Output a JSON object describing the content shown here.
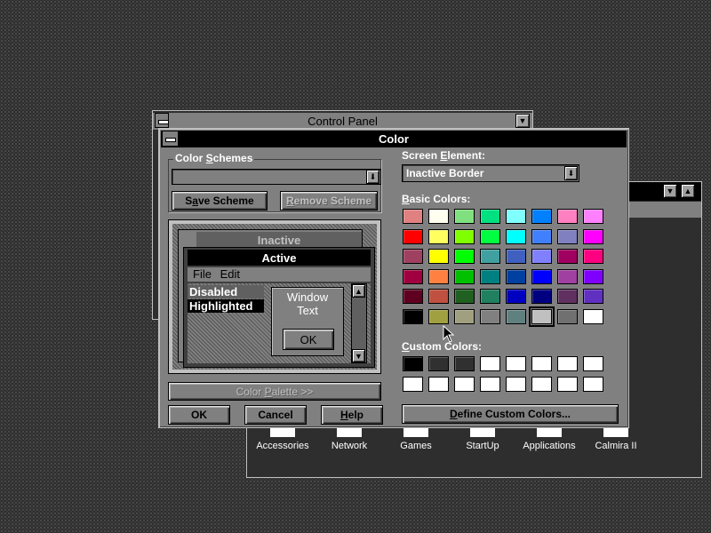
{
  "control_panel": {
    "title": "Control Panel"
  },
  "group_window": {
    "icons": [
      {
        "label": "Accessories"
      },
      {
        "label": "Network"
      },
      {
        "label": "Games"
      },
      {
        "label": "StartUp"
      },
      {
        "label": "Applications"
      },
      {
        "label": "Calmira II"
      }
    ]
  },
  "dialog": {
    "title": "Color",
    "color_schemes_label": "Color Schemes",
    "color_scheme_value": "",
    "save_scheme": "Save Scheme",
    "remove_scheme": "Remove Scheme",
    "preview": {
      "inactive_title": "Inactive",
      "active_title": "Active",
      "menu_file": "File",
      "menu_edit": "Edit",
      "disabled": "Disabled",
      "highlighted": "Highlighted",
      "window_text_1": "Window",
      "window_text_2": "Text",
      "ok": "OK"
    },
    "color_palette_button": "Color Palette >>",
    "ok_button": "OK",
    "cancel_button": "Cancel",
    "help_button": "Help",
    "screen_element_label": "Screen Element:",
    "screen_element_value": "Inactive Border",
    "basic_colors_label": "Basic Colors:",
    "custom_colors_label": "Custom Colors:",
    "define_custom_button": "Define Custom Colors...",
    "basic_colors": [
      [
        "#e08080",
        "#fffff0",
        "#80e080",
        "#00e080",
        "#80ffff",
        "#0080ff",
        "#ff80c0",
        "#ff80ff"
      ],
      [
        "#ff0000",
        "#ffff60",
        "#80ff00",
        "#00ff40",
        "#00ffff",
        "#4080ff",
        "#8080c0",
        "#ff00ff"
      ],
      [
        "#a04060",
        "#ffff00",
        "#00ff00",
        "#40a0a0",
        "#4060c0",
        "#8080ff",
        "#a00060",
        "#ff0080"
      ],
      [
        "#a00040",
        "#ff8040",
        "#00c000",
        "#008080",
        "#0040a0",
        "#0000ff",
        "#a040a0",
        "#8000ff"
      ],
      [
        "#600020",
        "#c05040",
        "#206020",
        "#208060",
        "#0000c0",
        "#000080",
        "#603060",
        "#6030c0"
      ],
      [
        "#000000",
        "#a0a040",
        "#a0a080",
        "#808080",
        "#608080",
        "#c0c0c0",
        "#707070",
        "#ffffff"
      ]
    ],
    "custom_colors": [
      [
        "#000000",
        "#303030",
        "#303030",
        "#ffffff",
        "#ffffff",
        "#ffffff",
        "#ffffff",
        "#ffffff"
      ],
      [
        "#ffffff",
        "#ffffff",
        "#ffffff",
        "#ffffff",
        "#ffffff",
        "#ffffff",
        "#ffffff",
        "#ffffff"
      ]
    ]
  },
  "colors": {
    "title_active": "#000000",
    "dialog_face": "#808080",
    "desktop": "#2e2e2e"
  }
}
